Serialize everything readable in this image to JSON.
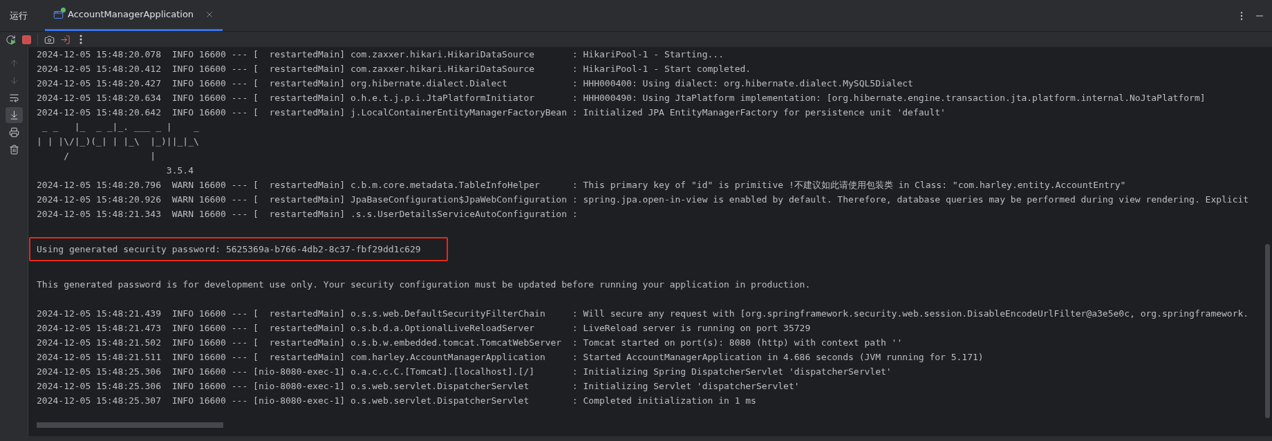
{
  "tool_window": {
    "title": "运行",
    "tabs": [
      {
        "label": "AccountManagerApplication",
        "selected": true,
        "running": true
      }
    ]
  },
  "toolbar": [
    {
      "kind": "rerun"
    },
    {
      "kind": "stop"
    },
    {
      "kind": "separator"
    },
    {
      "kind": "screenshot"
    },
    {
      "kind": "exit"
    },
    {
      "kind": "more"
    }
  ],
  "gutter_tools": [
    {
      "kind": "up",
      "disabled": true,
      "selected": false
    },
    {
      "kind": "down",
      "disabled": true,
      "selected": false
    },
    {
      "kind": "wrap",
      "disabled": false,
      "selected": false
    },
    {
      "kind": "scroll_end",
      "disabled": false,
      "selected": true
    },
    {
      "kind": "print",
      "disabled": false,
      "selected": false
    },
    {
      "kind": "clear",
      "disabled": false,
      "selected": false
    }
  ],
  "console": {
    "lines": [
      {
        "kind": "log",
        "text": "2024-12-05 15:48:20.078  INFO 16600 --- [  restartedMain] com.zaxxer.hikari.HikariDataSource       : HikariPool-1 - Starting..."
      },
      {
        "kind": "log",
        "text": "2024-12-05 15:48:20.412  INFO 16600 --- [  restartedMain] com.zaxxer.hikari.HikariDataSource       : HikariPool-1 - Start completed."
      },
      {
        "kind": "log",
        "text": "2024-12-05 15:48:20.427  INFO 16600 --- [  restartedMain] org.hibernate.dialect.Dialect            : HHH000400: Using dialect: org.hibernate.dialect.MySQL5Dialect"
      },
      {
        "kind": "log",
        "text": "2024-12-05 15:48:20.634  INFO 16600 --- [  restartedMain] o.h.e.t.j.p.i.JtaPlatformInitiator       : HHH000490: Using JtaPlatform implementation: [org.hibernate.engine.transaction.jta.platform.internal.NoJtaPlatform]"
      },
      {
        "kind": "log",
        "text": "2024-12-05 15:48:20.642  INFO 16600 --- [  restartedMain] j.LocalContainerEntityManagerFactoryBean : Initialized JPA EntityManagerFactory for persistence unit 'default'"
      },
      {
        "kind": "banner",
        "text": " _ _   |_  _ _|_. ___ _ |    _"
      },
      {
        "kind": "banner",
        "text": "| | |\\/|_)(_| | |_\\  |_)||_|_\\"
      },
      {
        "kind": "banner",
        "text": "     /               |"
      },
      {
        "kind": "banner",
        "text": "                        3.5.4"
      },
      {
        "kind": "log",
        "text": "2024-12-05 15:48:20.796  WARN 16600 --- [  restartedMain] c.b.m.core.metadata.TableInfoHelper      : This primary key of \"id\" is primitive !不建议如此请使用包装类 in Class: \"com.harley.entity.AccountEntry\""
      },
      {
        "kind": "log",
        "text": "2024-12-05 15:48:20.926  WARN 16600 --- [  restartedMain] JpaBaseConfiguration$JpaWebConfiguration : spring.jpa.open-in-view is enabled by default. Therefore, database queries may be performed during view rendering. Explicit"
      },
      {
        "kind": "log",
        "text": "2024-12-05 15:48:21.343  WARN 16600 --- [  restartedMain] .s.s.UserDetailsServiceAutoConfiguration :"
      },
      {
        "kind": "blank"
      },
      {
        "kind": "log",
        "text": "Using generated security password: 5625369a-b766-4db2-8c37-fbf29dd1c629",
        "highlighted": true
      },
      {
        "kind": "blank"
      },
      {
        "kind": "log",
        "text": "This generated password is for development use only. Your security configuration must be updated before running your application in production."
      },
      {
        "kind": "blank"
      },
      {
        "kind": "log",
        "text": "2024-12-05 15:48:21.439  INFO 16600 --- [  restartedMain] o.s.s.web.DefaultSecurityFilterChain     : Will secure any request with [org.springframework.security.web.session.DisableEncodeUrlFilter@a3e5e0c, org.springframework."
      },
      {
        "kind": "log",
        "text": "2024-12-05 15:48:21.473  INFO 16600 --- [  restartedMain] o.s.b.d.a.OptionalLiveReloadServer       : LiveReload server is running on port 35729"
      },
      {
        "kind": "log",
        "text": "2024-12-05 15:48:21.502  INFO 16600 --- [  restartedMain] o.s.b.w.embedded.tomcat.TomcatWebServer  : Tomcat started on port(s): 8080 (http) with context path ''"
      },
      {
        "kind": "log",
        "text": "2024-12-05 15:48:21.511  INFO 16600 --- [  restartedMain] com.harley.AccountManagerApplication     : Started AccountManagerApplication in 4.686 seconds (JVM running for 5.171)"
      },
      {
        "kind": "log",
        "text": "2024-12-05 15:48:25.306  INFO 16600 --- [nio-8080-exec-1] o.a.c.c.C.[Tomcat].[localhost].[/]       : Initializing Spring DispatcherServlet 'dispatcherServlet'"
      },
      {
        "kind": "log",
        "text": "2024-12-05 15:48:25.306  INFO 16600 --- [nio-8080-exec-1] o.s.web.servlet.DispatcherServlet        : Initializing Servlet 'dispatcherServlet'"
      },
      {
        "kind": "log",
        "text": "2024-12-05 15:48:25.307  INFO 16600 --- [nio-8080-exec-1] o.s.web.servlet.DispatcherServlet        : Completed initialization in 1 ms"
      }
    ]
  }
}
